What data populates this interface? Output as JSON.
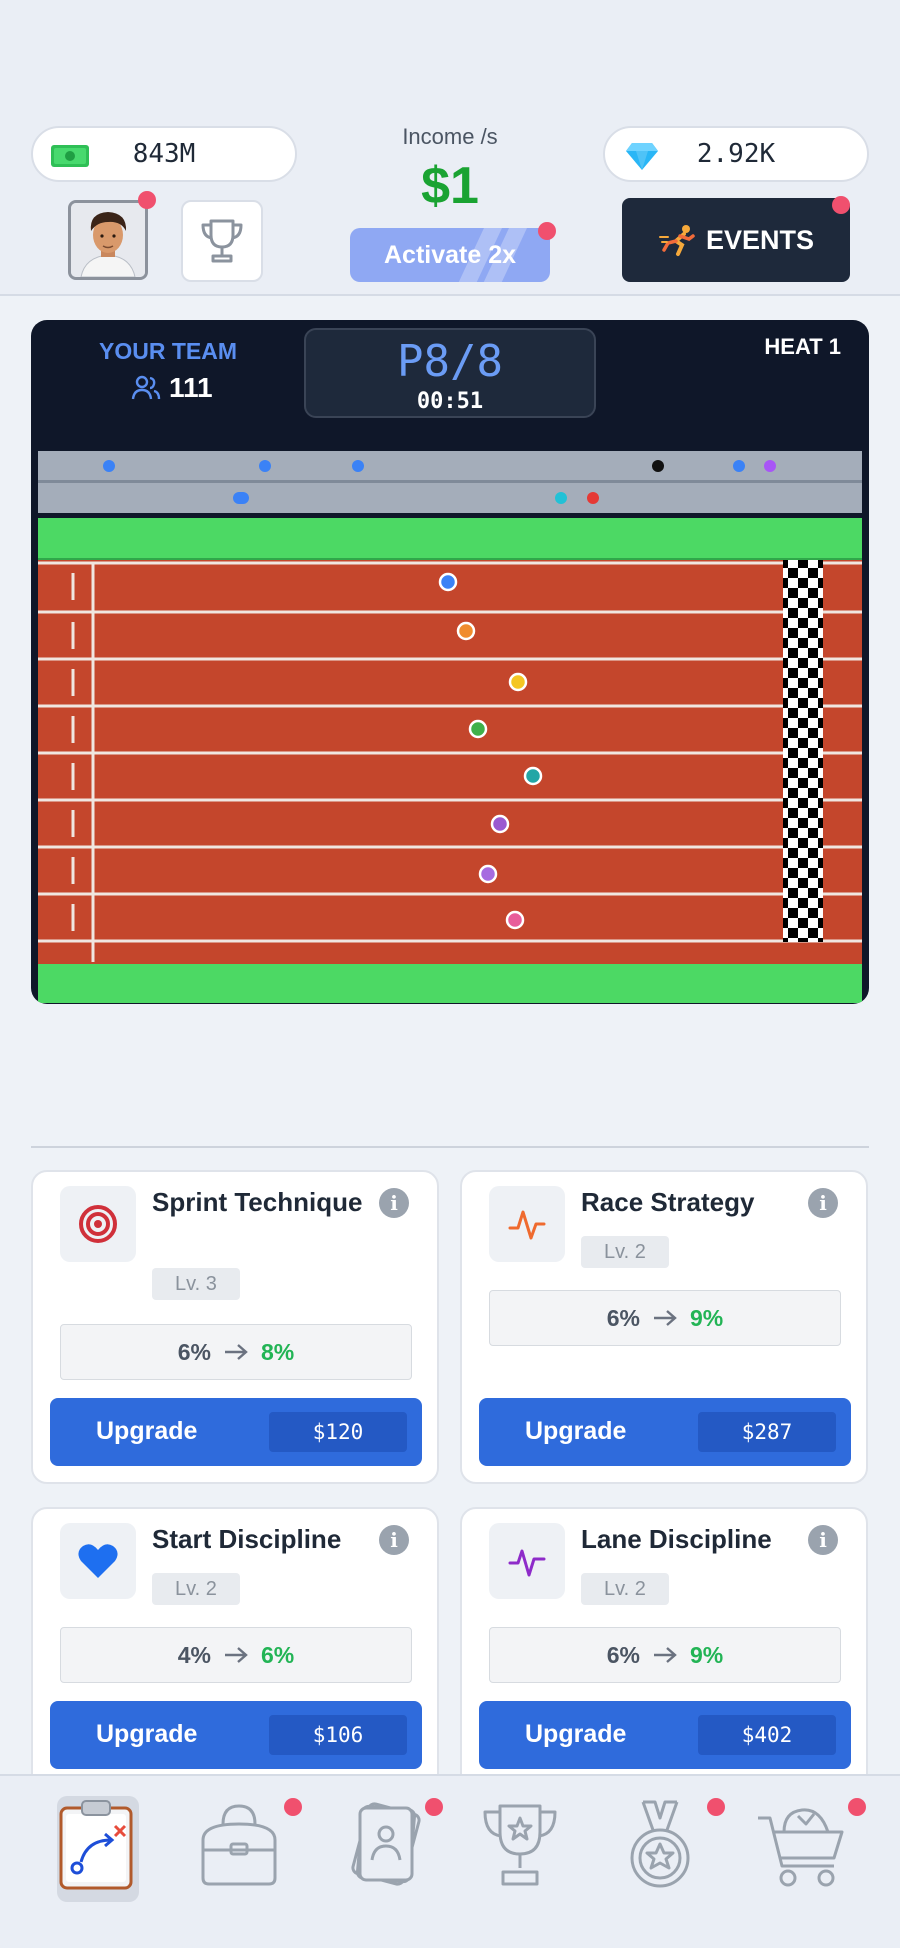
{
  "header": {
    "cash": "843M",
    "gems": "2.92K",
    "income_label": "Income /s",
    "income_value": "$1",
    "activate_label": "Activate 2x",
    "events_label": "EVENTS"
  },
  "race": {
    "team_label": "YOUR TEAM",
    "team_count": "111",
    "position": "P8/8",
    "timer": "00:51",
    "heat": "HEAT 1"
  },
  "upgrades": [
    {
      "title": "Sprint Technique",
      "level": "Lv. 3",
      "from": "6%",
      "to": "8%",
      "button": "Upgrade",
      "price": "$120",
      "icon": "target-icon"
    },
    {
      "title": "Race Strategy",
      "level": "Lv. 2",
      "from": "6%",
      "to": "9%",
      "button": "Upgrade",
      "price": "$287",
      "icon": "pulse-icon"
    },
    {
      "title": "Start Discipline",
      "level": "Lv. 2",
      "from": "4%",
      "to": "6%",
      "button": "Upgrade",
      "price": "$106",
      "icon": "heart-icon"
    },
    {
      "title": "Lane Discipline",
      "level": "Lv. 2",
      "from": "6%",
      "to": "9%",
      "button": "Upgrade",
      "price": "$402",
      "icon": "heartbeat-icon"
    }
  ],
  "nav": [
    "strategy-icon",
    "gym-bag-icon",
    "cards-icon",
    "trophy-icon",
    "medal-icon",
    "shop-cart-icon"
  ],
  "colors": {
    "accent": "#2f6bdc",
    "income": "#1aa332",
    "notification": "#f0506e",
    "panel": "#0f1729"
  }
}
